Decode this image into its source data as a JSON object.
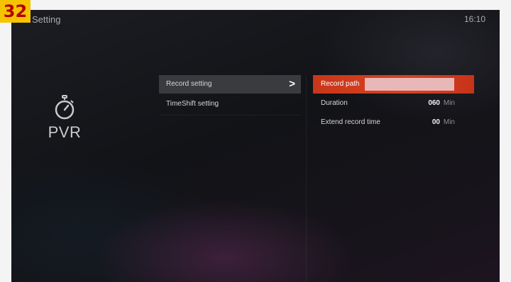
{
  "badge": "32",
  "header": {
    "title": "Setting",
    "clock": "16:10"
  },
  "category": {
    "label": "PVR",
    "icon": "stopwatch-icon"
  },
  "menu": {
    "items": [
      {
        "label": "Record setting",
        "selected": true,
        "arrow": ">"
      },
      {
        "label": "TimeShift setting",
        "selected": false
      }
    ]
  },
  "settings": {
    "record_path": {
      "label": "Record path",
      "value": ""
    },
    "duration": {
      "label": "Duration",
      "value": "060",
      "unit": "Min"
    },
    "extend_record_time": {
      "label": "Extend record time",
      "value": "00",
      "unit": "Min"
    }
  },
  "colors": {
    "accent": "#d9421f",
    "badge_bg": "#f6c300",
    "badge_text": "#b40000"
  }
}
